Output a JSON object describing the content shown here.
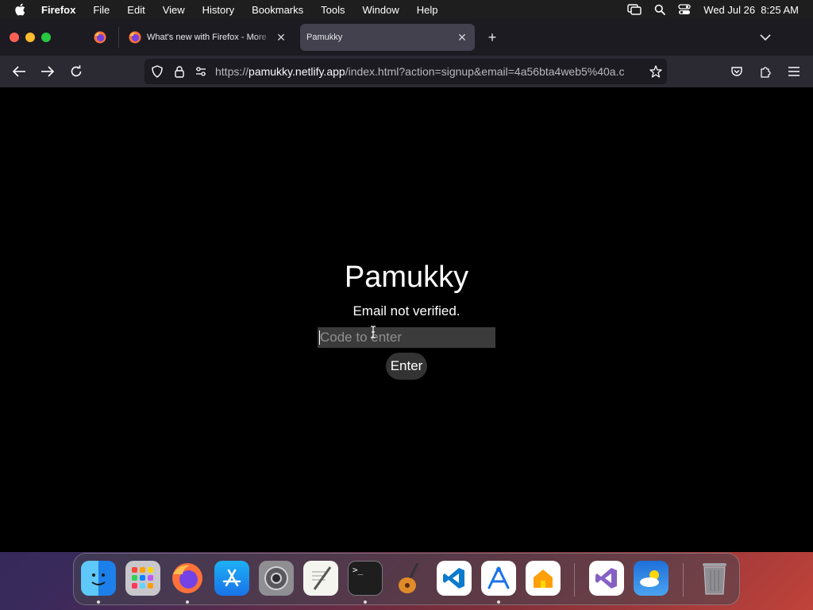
{
  "menubar": {
    "app_name": "Firefox",
    "items": [
      "File",
      "Edit",
      "View",
      "History",
      "Bookmarks",
      "Tools",
      "Window",
      "Help"
    ],
    "datetime": "Wed Jul 26  8:25 AM"
  },
  "browser": {
    "tabs": [
      {
        "title": "What's new with Firefox - More",
        "active": false
      },
      {
        "title": "Pamukky",
        "active": true
      }
    ],
    "url": {
      "scheme": "https://",
      "host": "pamukky.netlify.app",
      "path": "/index.html?action=signup&email=4a56bta4web5%40a.c"
    }
  },
  "page": {
    "title": "Pamukky",
    "status": "Email not verified.",
    "code_placeholder": "Code to enter",
    "code_value": "",
    "enter_label": "Enter"
  },
  "dock": {
    "apps": [
      {
        "icon": "finder-icon",
        "running": true
      },
      {
        "icon": "launchpad-icon",
        "running": false
      },
      {
        "icon": "firefox-icon",
        "running": true
      },
      {
        "icon": "app-store-icon",
        "running": false
      },
      {
        "icon": "system-settings-icon",
        "running": false
      },
      {
        "icon": "textedit-icon",
        "running": false
      },
      {
        "icon": "terminal-icon",
        "running": true
      },
      {
        "icon": "garageband-icon",
        "running": false
      },
      {
        "icon": "vscode-icon",
        "running": false
      },
      {
        "icon": "instruments-icon",
        "running": true
      },
      {
        "icon": "home-icon",
        "running": false
      },
      {
        "icon": "visual-studio-icon",
        "running": false
      },
      {
        "icon": "weather-icon",
        "running": false
      },
      {
        "icon": "trash-icon",
        "running": false
      }
    ]
  },
  "colors": {
    "page_background": "#000000",
    "input_background": "#3b3b3b",
    "button_background": "#333333",
    "tabbar_background": "#1c1b22",
    "toolbar_background": "#2b2a33"
  }
}
